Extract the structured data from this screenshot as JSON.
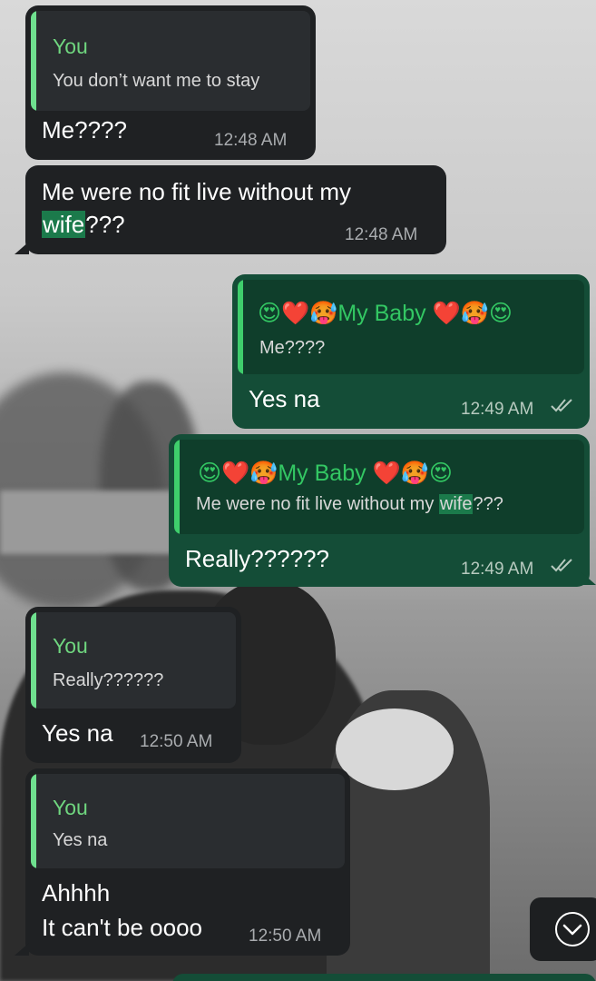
{
  "messages": [
    {
      "direction": "incoming",
      "quote_author": "You",
      "quote_text": "You don’t want me to stay",
      "text": "Me????",
      "time": "12:48 AM"
    },
    {
      "direction": "incoming",
      "text_line1": "Me were no fit live without my",
      "text_line2_highlight": "wife",
      "text_line2_rest": "???",
      "time": "12:48 AM"
    },
    {
      "direction": "outgoing",
      "quote_author": "My Baby",
      "quote_text": "Me????",
      "text": "Yes na",
      "time": "12:49 AM",
      "status": "read"
    },
    {
      "direction": "outgoing",
      "quote_author": "My Baby",
      "quote_text_before": "Me were no fit live without my ",
      "quote_text_highlight": "wife",
      "quote_text_after": "???",
      "text": "Really??????",
      "time": "12:49 AM",
      "status": "read"
    },
    {
      "direction": "incoming",
      "quote_author": "You",
      "quote_text": "Really??????",
      "text": "Yes na",
      "time": "12:50 AM"
    },
    {
      "direction": "incoming",
      "quote_author": "You",
      "quote_text": "Yes na",
      "text_line1": "Ahhhh",
      "text_line2": "It can't be oooo",
      "time": "12:50 AM"
    }
  ],
  "emoji": {
    "heart_eyes": "😍",
    "heart": "❤️",
    "hot_face": "🥵"
  },
  "icons": {
    "read_ticks": "double-check-icon",
    "scroll_down": "chevron-down-circle-icon"
  },
  "colors": {
    "incoming_bubble": "#1f2123",
    "outgoing_bubble": "#144d37",
    "quote_author_green": "#6fd67f",
    "highlight": "#1b7a4b"
  }
}
